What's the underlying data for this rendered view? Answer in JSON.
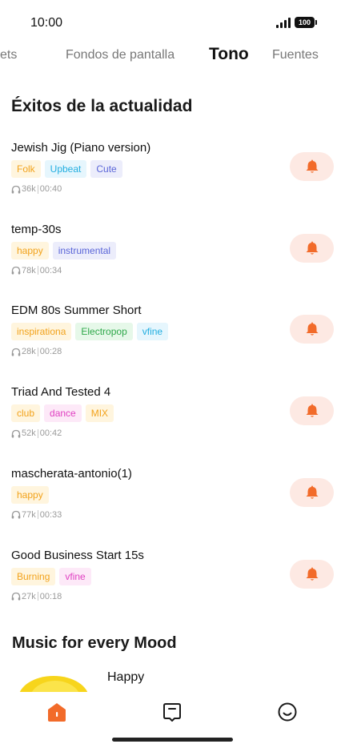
{
  "status_bar": {
    "time": "10:00",
    "battery": "100"
  },
  "tabs": [
    {
      "label": "ets",
      "active": false
    },
    {
      "label": "Fondos de pantalla",
      "active": false
    },
    {
      "label": "Tono",
      "active": true
    },
    {
      "label": "Fuentes",
      "active": false
    }
  ],
  "sections": {
    "trending_title": "Éxitos de la actualidad",
    "mood_title": "Music for every Mood"
  },
  "songs": [
    {
      "title": "Jewish Jig (Piano version)",
      "tags": [
        "Folk",
        "Upbeat",
        "Cute"
      ],
      "plays": "36k",
      "duration": "00:40"
    },
    {
      "title": "temp-30s",
      "tags": [
        "happy",
        "instrumental"
      ],
      "plays": "78k",
      "duration": "00:34"
    },
    {
      "title": "EDM 80s Summer Short",
      "tags": [
        "inspirationa",
        "Electropop",
        "vfine"
      ],
      "plays": "28k",
      "duration": "00:28"
    },
    {
      "title": "Triad And Tested 4",
      "tags": [
        "club",
        "dance",
        "MIX"
      ],
      "plays": "52k",
      "duration": "00:42"
    },
    {
      "title": "mascherata-antonio(1)",
      "tags": [
        "happy"
      ],
      "plays": "77k",
      "duration": "00:33"
    },
    {
      "title": "Good Business Start 15s",
      "tags": [
        "Burning",
        "vfine"
      ],
      "plays": "27k",
      "duration": "00:18"
    }
  ],
  "mood": {
    "label": "Happy"
  },
  "bottom_nav": [
    {
      "icon": "home-icon",
      "active": true
    },
    {
      "icon": "bookmark-icon",
      "active": false
    },
    {
      "icon": "smile-icon",
      "active": false
    }
  ],
  "colors": {
    "accent": "#f26b2a",
    "bell_bg": "#fde9e3",
    "tag_yellow": {
      "bg": "#fff5de",
      "fg": "#f2a21b"
    },
    "tag_blue": {
      "bg": "#e6f6fd",
      "fg": "#22aee0"
    },
    "tag_indigo": {
      "bg": "#ecedfb",
      "fg": "#5a65d8"
    },
    "tag_green": {
      "bg": "#e6f8e9",
      "fg": "#2ea84a"
    },
    "tag_pink": {
      "bg": "#fde9f8",
      "fg": "#e040c2"
    }
  }
}
